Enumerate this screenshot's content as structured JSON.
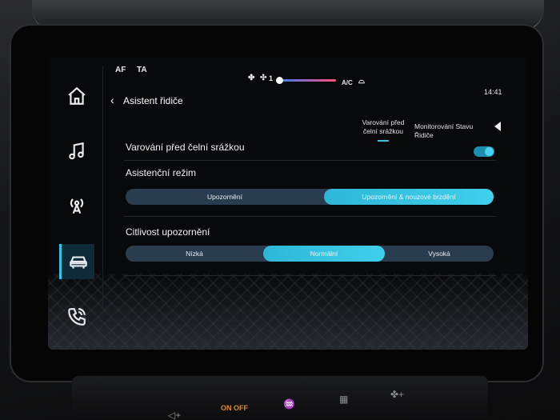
{
  "status_bar": {
    "af": "AF",
    "ta": "TA",
    "fan_level": "1",
    "ac": "A/C",
    "time": "14:41"
  },
  "header": {
    "title": "Asistent řidiče"
  },
  "tabs": [
    {
      "line1": "Varování před",
      "line2": "čelní srážkou",
      "selected": true
    },
    {
      "line1": "Monitorování Stavu Řidiče",
      "line2": "",
      "selected": false
    }
  ],
  "settings": {
    "collision_warning": {
      "label": "Varování před čelní srážkou",
      "enabled": true
    },
    "assist_mode": {
      "label": "Asistenční režim",
      "options": [
        "Upozornění",
        "Upozornění & nouzové brzdění"
      ],
      "selected": "Upozornění & nouzové brzdění"
    },
    "sensitivity": {
      "label": "Citlivost upozornění",
      "options": [
        "Nízká",
        "Normální",
        "Vysoká"
      ],
      "selected": "Normální"
    }
  },
  "sidebar": {
    "items": [
      {
        "icon": "home-icon",
        "active": false
      },
      {
        "icon": "music-icon",
        "active": false
      },
      {
        "icon": "radio-icon",
        "active": false
      },
      {
        "icon": "car-icon",
        "active": true
      },
      {
        "icon": "phone-icon",
        "active": false
      }
    ]
  },
  "hardware": {
    "hazard_label_on": "ON",
    "hazard_label_off": "OFF"
  },
  "colors": {
    "accent": "#2fc4e0",
    "segment_bg": "#2a3c4f",
    "screen_bg": "#08090b"
  }
}
